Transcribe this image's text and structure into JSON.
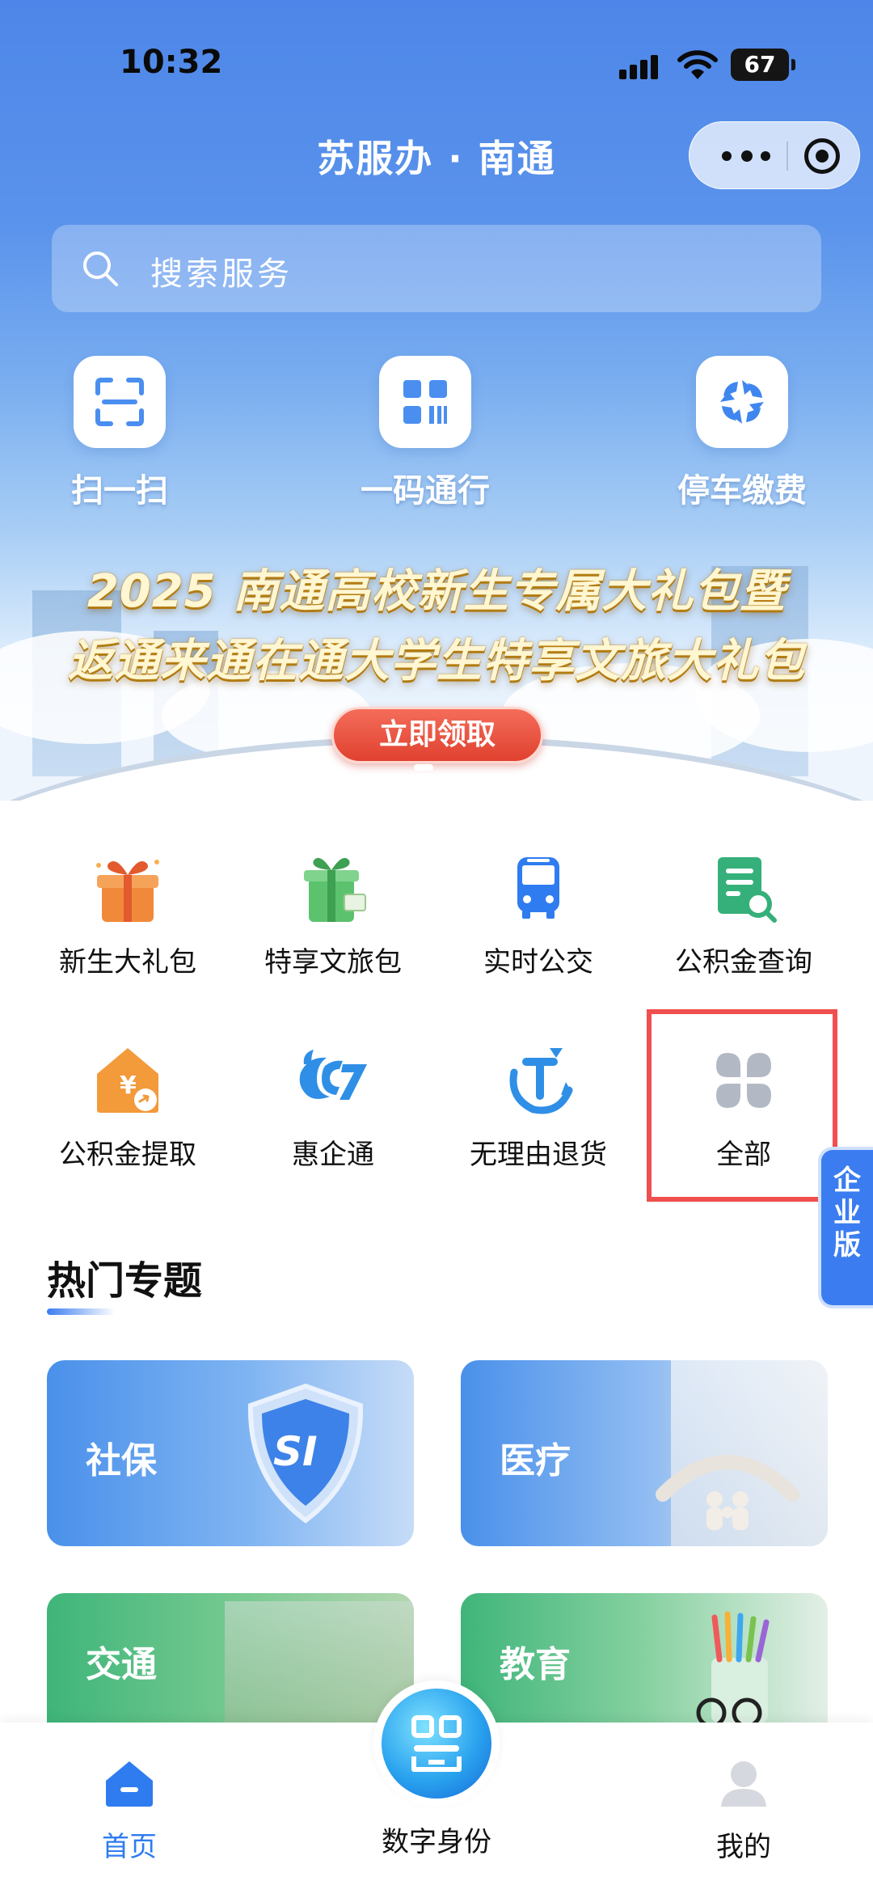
{
  "status_bar": {
    "time": "10:32",
    "battery": "67"
  },
  "header": {
    "title": "苏服办 · 南通"
  },
  "search": {
    "placeholder": "搜索服务"
  },
  "quick_actions": [
    {
      "label": "扫一扫",
      "icon": "scan-icon"
    },
    {
      "label": "一码通行",
      "icon": "qr-code-icon"
    },
    {
      "label": "停车缴费",
      "icon": "parking-payment-icon"
    }
  ],
  "banner": {
    "line1": "2025 南通高校新生专属大礼包暨",
    "line2": "返通来通在通大学生特享文旅大礼包",
    "button": "立即领取"
  },
  "services": [
    {
      "label": "新生大礼包",
      "icon": "gift-box-icon"
    },
    {
      "label": "特享文旅包",
      "icon": "travel-gift-icon"
    },
    {
      "label": "实时公交",
      "icon": "bus-icon"
    },
    {
      "label": "公积金查询",
      "icon": "fund-query-icon"
    },
    {
      "label": "公积金提取",
      "icon": "fund-withdraw-icon"
    },
    {
      "label": "惠企通",
      "icon": "hui-qi-tong-icon"
    },
    {
      "label": "无理由退货",
      "icon": "return-goods-icon"
    },
    {
      "label": "全部",
      "icon": "all-services-icon"
    }
  ],
  "side_tab": {
    "line1": "企",
    "line2": "业",
    "line3": "版"
  },
  "hot_topics": {
    "title": "热门专题",
    "cards": [
      {
        "label": "社保",
        "badge": "SI"
      },
      {
        "label": "医疗"
      },
      {
        "label": "交通"
      },
      {
        "label": "教育"
      }
    ]
  },
  "tab_bar": [
    {
      "label": "首页",
      "icon": "home-icon",
      "active": true
    },
    {
      "label": "数字身份",
      "icon": "digital-id-icon",
      "active": false
    },
    {
      "label": "我的",
      "icon": "profile-icon",
      "active": false
    }
  ],
  "colors": {
    "accent": "#3b7df1",
    "highlight": "#ef4f4f",
    "claim_button": "#e8503d"
  }
}
